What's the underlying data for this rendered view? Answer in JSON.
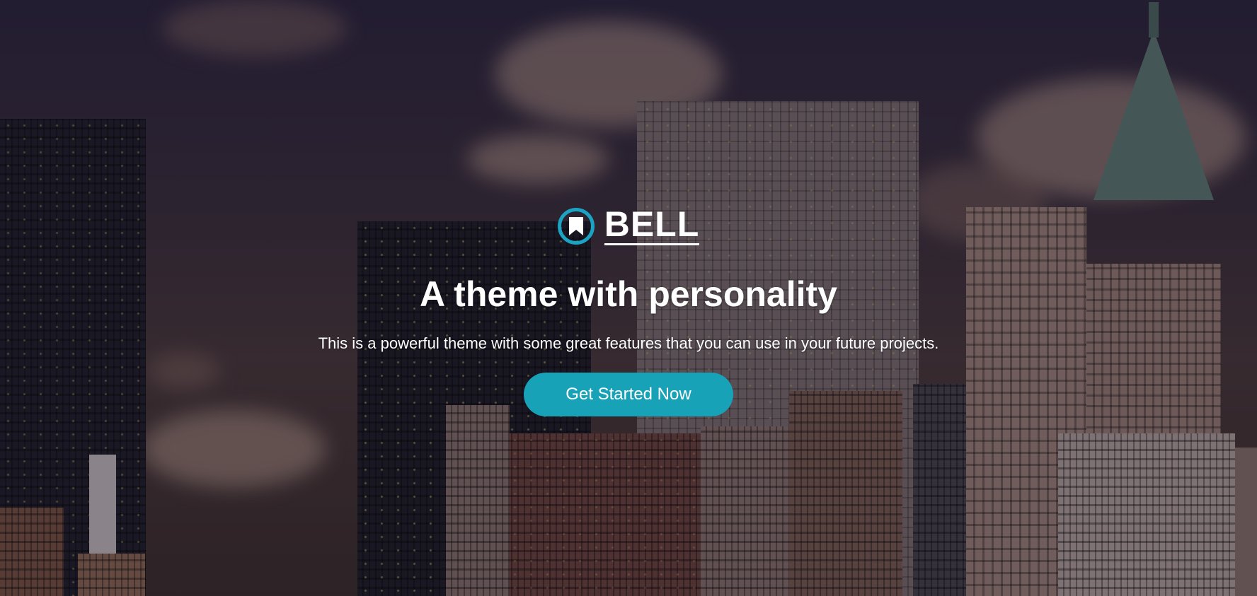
{
  "brand": {
    "name": "BELL",
    "accent_color": "#1aa3c2",
    "logo_icon": "bookmark-icon"
  },
  "hero": {
    "headline": "A theme with personality",
    "subline": "This is a powerful theme with some great features that you can use in your future projects.",
    "cta_label": "Get Started Now",
    "cta_color": "#17a2b8"
  }
}
